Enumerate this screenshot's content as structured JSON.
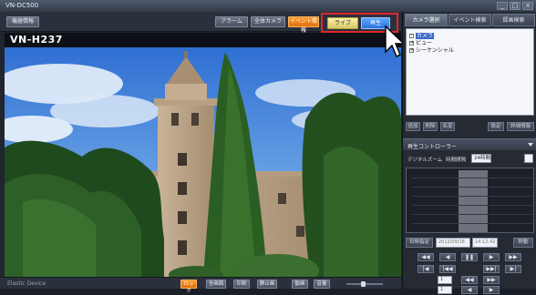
{
  "window": {
    "title": "VN-DC500",
    "controls": [
      "_",
      "□",
      "×"
    ]
  },
  "toolbar": {
    "left_button": "機器情報",
    "buttons": [
      "アラーム",
      "全体カメラ",
      "イベント情報"
    ],
    "mode_live": "ライブ",
    "mode_playback": "再生"
  },
  "camera": {
    "name": "VN-H237"
  },
  "bottombar": {
    "model_text": "Elastic Device",
    "buttons": [
      "ロック",
      "全画面",
      "印刷",
      "静止画",
      "動画",
      "音量"
    ]
  },
  "right_panel": {
    "tabs": [
      "カメラ選択",
      "イベント検索",
      "録画検索"
    ],
    "tree": {
      "root": "カメラ",
      "child1": "ビュー",
      "child2": "シーケンシャル"
    },
    "tree_buttons": [
      "追加",
      "削除",
      "名変",
      "設定",
      "詳細情報"
    ],
    "playback_controller": {
      "title": "再生コントローラー",
      "digital_zoom": "デジタルズーム",
      "time_interval_label": "時間間隔",
      "time_interval_value": "24時間",
      "datetime_label": "日時指定",
      "date_value": "2012/09/18",
      "time_value": "14:12:42",
      "go_label": "移動",
      "transport_row1": [
        "◀◀",
        "◀",
        "❚❚",
        "▶",
        "▶▶"
      ],
      "transport_row2": [
        "|◀",
        "|◀◀",
        "▶▶|",
        "▶|"
      ],
      "speed_row1": [
        "1",
        "◀◀",
        "▶▶"
      ],
      "speed_row2": [
        "1",
        "◀",
        "▶"
      ]
    }
  },
  "colors": {
    "highlight_box": "#e0262a",
    "accent_orange": "#f08a1e",
    "play_blue": "#2f76e0"
  },
  "icons": [
    "cursor-arrow-icon",
    "expand-icon",
    "dropdown-arrow-icon"
  ]
}
